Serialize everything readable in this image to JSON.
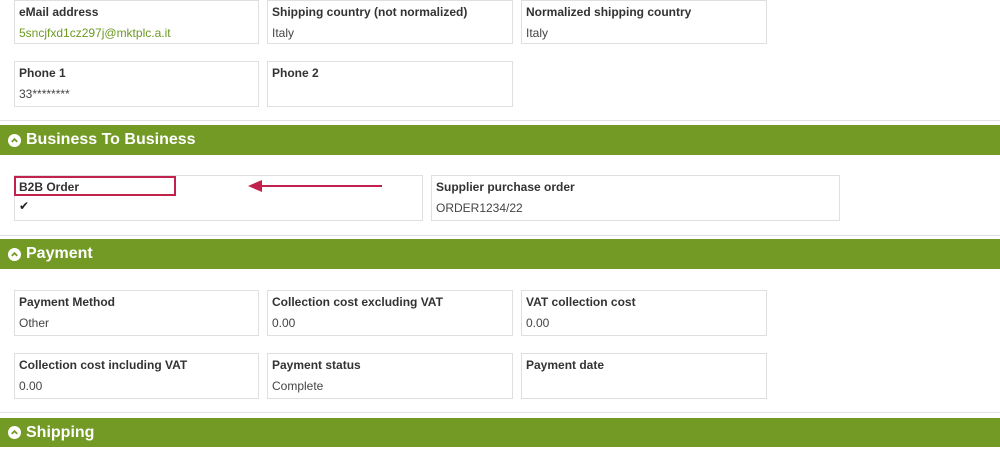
{
  "contact": {
    "email": {
      "label": "eMail address",
      "value": "5sncjfxd1cz297j@mktplc.a.it"
    },
    "shipping_country": {
      "label": "Shipping country (not normalized)",
      "value": "Italy"
    },
    "normalized_country": {
      "label": "Normalized shipping country",
      "value": "Italy"
    },
    "phone1": {
      "label": "Phone 1",
      "value": "33********"
    },
    "phone2": {
      "label": "Phone 2",
      "value": ""
    }
  },
  "b2b": {
    "title": "Business To Business",
    "order": {
      "label": "B2B Order",
      "value": "✔"
    },
    "supplier_po": {
      "label": "Supplier purchase order",
      "value": "ORDER1234/22"
    }
  },
  "payment": {
    "title": "Payment",
    "method": {
      "label": "Payment Method",
      "value": "Other"
    },
    "cost_excl": {
      "label": "Collection cost excluding VAT",
      "value": "0.00"
    },
    "vat_cost": {
      "label": "VAT collection cost",
      "value": "0.00"
    },
    "cost_incl": {
      "label": "Collection cost including VAT",
      "value": "0.00"
    },
    "status": {
      "label": "Payment status",
      "value": "Complete"
    },
    "date": {
      "label": "Payment date",
      "value": ""
    }
  },
  "shipping": {
    "title": "Shipping"
  },
  "colors": {
    "section_header": "#739a25",
    "highlight": "#c2214e",
    "email_link": "#6d9a23"
  },
  "icons": {
    "section_toggle": "chevron-up-circle-icon",
    "annotation": "arrow-left-icon",
    "checkmark": "check-icon"
  }
}
